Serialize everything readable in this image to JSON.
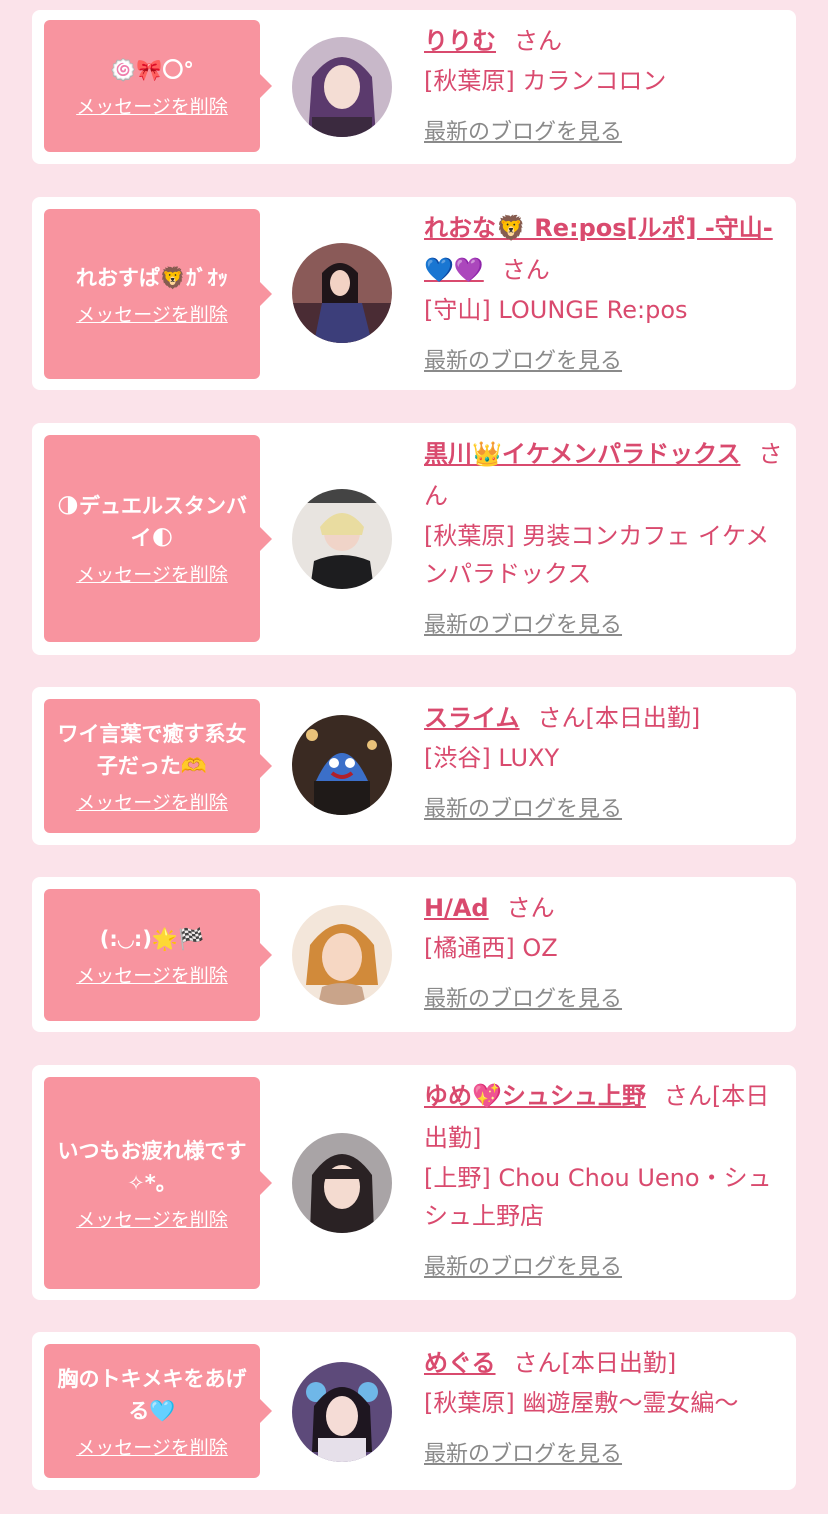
{
  "colors": {
    "background": "#fbe3ea",
    "bubble": "#f8949f",
    "accent": "#d94a6e",
    "link_muted": "#8a8a8a"
  },
  "cards": [
    {
      "message": "🍥🎀〇°",
      "delete_label": "メッセージを削除",
      "name": "りりむ",
      "suffix": "さん",
      "shop": "[秋葉原] カランコロン",
      "blog_label": "最新のブログを見る",
      "avatar_icon": "avatar-photo"
    },
    {
      "message": "れおすぱ🦁ｶﾞｵｯ",
      "delete_label": "メッセージを削除",
      "name": "れおな🦁 Re:pos[ルポ] -守山-💙💜",
      "suffix": "さん",
      "shop": "[守山] LOUNGE Re:pos",
      "blog_label": "最新のブログを見る",
      "avatar_icon": "avatar-photo"
    },
    {
      "message": "🌗デュエルスタンバイ🌓",
      "delete_label": "メッセージを削除",
      "name": "黒川👑イケメンパラドックス",
      "suffix": "さん",
      "shop": "[秋葉原] 男装コンカフェ イケメンパラドックス",
      "blog_label": "最新のブログを見る",
      "avatar_icon": "avatar-photo"
    },
    {
      "message": "ワイ言葉で癒す系女子だった🫶",
      "delete_label": "メッセージを削除",
      "name": "スライム",
      "suffix": "さん[本日出勤]",
      "shop": "[渋谷] LUXY",
      "blog_label": "最新のブログを見る",
      "avatar_icon": "avatar-photo"
    },
    {
      "message": "(:◡:)🌟🏁",
      "delete_label": "メッセージを削除",
      "name": "H/Ad",
      "suffix": "さん",
      "shop": "[橘通西] OZ",
      "blog_label": "最新のブログを見る",
      "avatar_icon": "avatar-photo"
    },
    {
      "message": "いつもお疲れ様です✧*。",
      "delete_label": "メッセージを削除",
      "name": "ゆめ💖シュシュ上野",
      "suffix": "さん[本日出勤]",
      "shop": "[上野] Chou Chou Ueno・シュシュ上野店",
      "blog_label": "最新のブログを見る",
      "avatar_icon": "avatar-photo"
    },
    {
      "message": "胸のトキメキをあげる🩵",
      "delete_label": "メッセージを削除",
      "name": "めぐる",
      "suffix": "さん[本日出勤]",
      "shop": "[秋葉原] 幽遊屋敷〜霊女編〜",
      "blog_label": "最新のブログを見る",
      "avatar_icon": "avatar-photo"
    }
  ]
}
